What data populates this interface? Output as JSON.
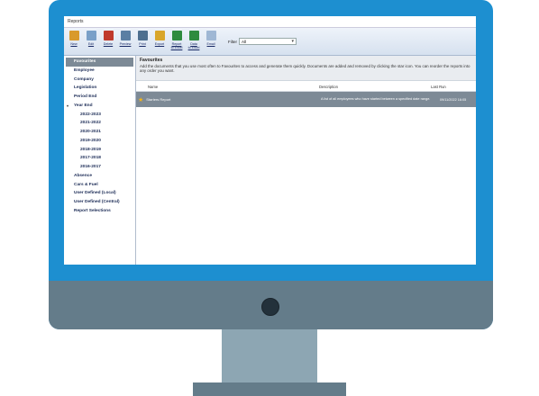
{
  "window": {
    "title": "Reports"
  },
  "toolbar": {
    "buttons": [
      {
        "label": "New",
        "color": "#d99a2b"
      },
      {
        "label": "Edit",
        "color": "#7aa0c8"
      },
      {
        "label": "Delete",
        "color": "#c0392b"
      },
      {
        "label": "Preview",
        "color": "#5b7fa3"
      },
      {
        "label": "Print",
        "color": "#4d6f8f"
      },
      {
        "label": "Export",
        "color": "#d9a62b"
      },
      {
        "label": "Report\nto Excel",
        "color": "#2e8b3e"
      },
      {
        "label": "Data\nto Excel",
        "color": "#2e8b3e"
      },
      {
        "label": "Email",
        "color": "#9fb7d4"
      }
    ],
    "filter_label": "Filter",
    "filter_value": "All"
  },
  "sidebar": {
    "items": [
      {
        "label": "Favourites",
        "selected": true
      },
      {
        "label": "Employee"
      },
      {
        "label": "Company"
      },
      {
        "label": "Legislation"
      },
      {
        "label": "Period End"
      },
      {
        "label": "Year End",
        "expanded": true
      },
      {
        "label": "2022-2023",
        "sub": true
      },
      {
        "label": "2021-2022",
        "sub": true
      },
      {
        "label": "2020-2021",
        "sub": true
      },
      {
        "label": "2019-2020",
        "sub": true
      },
      {
        "label": "2018-2019",
        "sub": true
      },
      {
        "label": "2017-2018",
        "sub": true
      },
      {
        "label": "2016-2017",
        "sub": true
      },
      {
        "label": "Absence"
      },
      {
        "label": "Cars & Fuel"
      },
      {
        "label": "User Defined (Local)"
      },
      {
        "label": "User Defined (Central)"
      },
      {
        "label": "Report Selections"
      }
    ]
  },
  "main": {
    "title": "Favourites",
    "description": "Add the documents that you use most often to Favourites to access and generate them quickly. Documents are added and removed by clicking the star icon. You can reorder the reports into any order you want.",
    "columns": {
      "name": "Name",
      "description": "Description",
      "last_run": "Last Run"
    },
    "rows": [
      {
        "name": "Starters Report",
        "description": "A list of all employees who have started between a specified date range.",
        "last_run": "09/11/2022 16:05"
      }
    ]
  }
}
